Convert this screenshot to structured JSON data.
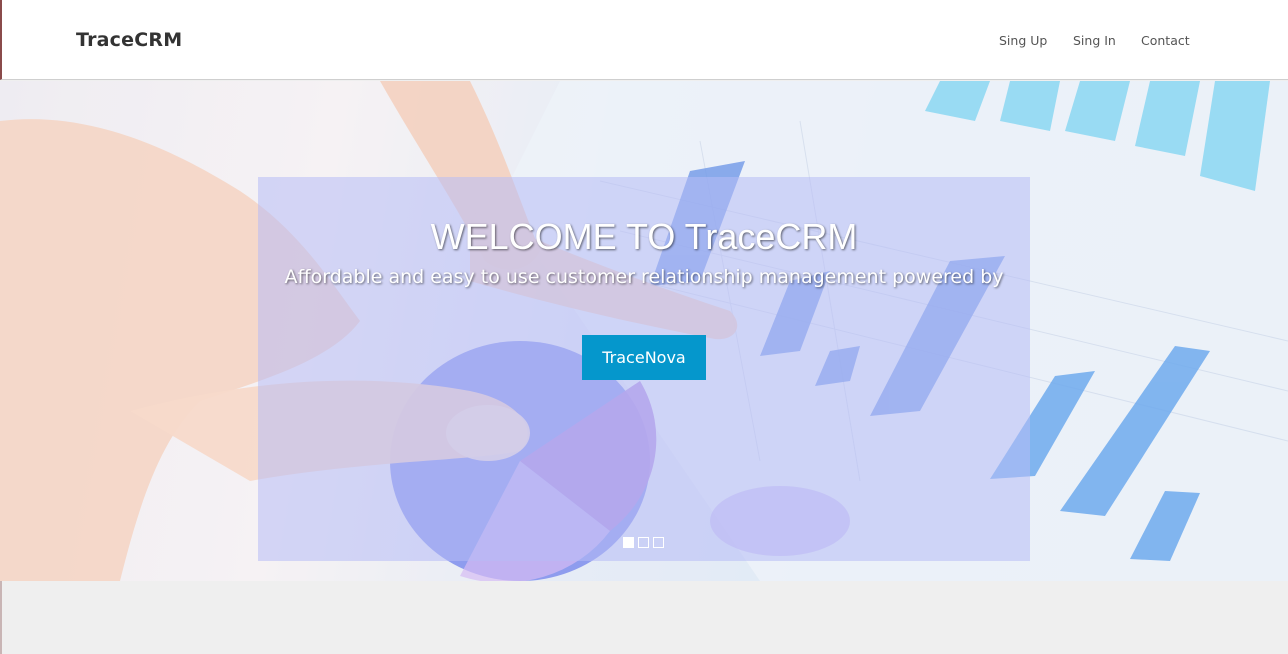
{
  "navbar": {
    "brand": "TraceCRM",
    "links": [
      {
        "label": "Sing Up"
      },
      {
        "label": "Sing In"
      },
      {
        "label": "Contact"
      }
    ]
  },
  "hero": {
    "title": "WELCOME TO TraceCRM",
    "subtitle": "Affordable and easy to use customer relationship management powered by",
    "button_label": "TraceNova",
    "slides": {
      "count": 3,
      "active": 1
    }
  },
  "colors": {
    "overlay": "#b7bcf6",
    "button": "#0597cc",
    "page_background": "#efefef"
  }
}
